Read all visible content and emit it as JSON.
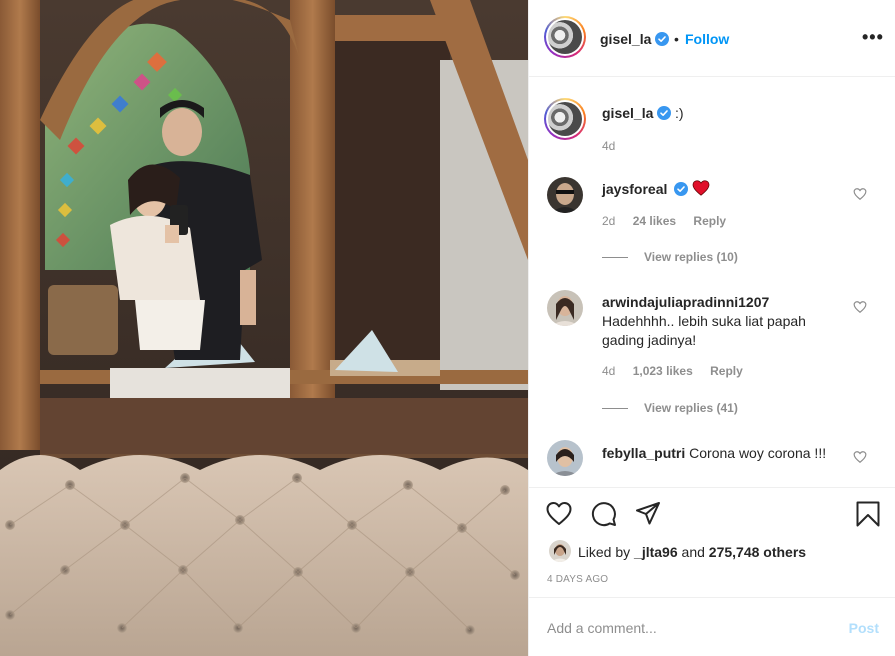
{
  "post": {
    "author": "gisel_la",
    "follow_label": "Follow",
    "separator": "•",
    "more_label": "•••",
    "caption_text": ":)",
    "caption_time": "4d"
  },
  "comments": [
    {
      "username": "jaysforeal",
      "text": "",
      "emoji": "heart",
      "time": "2d",
      "likes": "24 likes",
      "reply_label": "Reply",
      "view_replies": "View replies (10)"
    },
    {
      "username": "arwindajuliapradinni1207",
      "text": "Hadehhhh.. lebih suka liat papah gading jadinya!",
      "time": "4d",
      "likes": "1,023 likes",
      "reply_label": "Reply",
      "view_replies": "View replies (41)"
    },
    {
      "username": "febylla_putri",
      "text": "Corona woy corona !!!"
    }
  ],
  "likes": {
    "prefix": "Liked by",
    "user": "_jlta96",
    "joiner": "and",
    "others": "275,748 others"
  },
  "timestamp": "4 DAYS AGO",
  "add_comment": {
    "placeholder": "Add a comment...",
    "post_label": "Post"
  },
  "icons": {
    "like": "heart-outline-icon",
    "comment": "speech-bubble-icon",
    "share": "paper-plane-icon",
    "save": "bookmark-icon",
    "verified": "verified-badge-icon"
  },
  "colors": {
    "link": "#0095f6",
    "verified": "#3897f0",
    "heart": "#ed4956",
    "post_disabled": "#b2dffc",
    "muted": "#8e8e8e"
  }
}
